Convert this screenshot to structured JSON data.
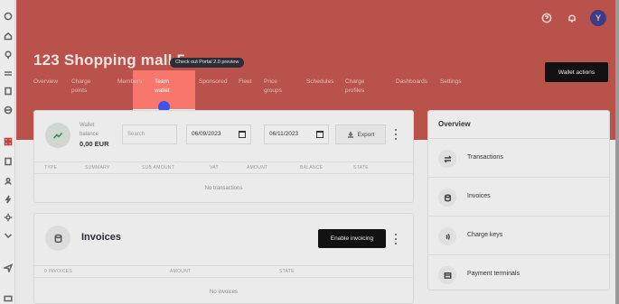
{
  "sidebar": {
    "icons": [
      "loader-icon",
      "home-icon",
      "lightbulb-icon",
      "transfer-icon",
      "invoice-icon",
      "globe-icon",
      "grid-icon",
      "building-icon",
      "bolt-icon",
      "sun-icon",
      "route-icon",
      "send-icon",
      "card-icon"
    ]
  },
  "header": {
    "title": "123 Shopping mall 5",
    "portal_badge": "Check out Portal 2.0 preview",
    "wallet_actions": "Wallet actions",
    "avatar_initial": "Y"
  },
  "tabs": [
    {
      "label": "Overview"
    },
    {
      "label": "Charge\npoints"
    },
    {
      "label": "Members"
    },
    {
      "label": "Team\nwallet"
    },
    {
      "label": "Sponsored"
    },
    {
      "label": "Fleet"
    },
    {
      "label": "Price\ngroups"
    },
    {
      "label": "Schedules"
    },
    {
      "label": "Charge\nprofiles"
    },
    {
      "label": "Dashboards"
    },
    {
      "label": "Settings"
    }
  ],
  "wallet": {
    "label_line1": "Wallet",
    "label_line2": "balance",
    "amount": "0,00 EUR",
    "search_placeholder": "Search",
    "date_from": "06/09/2023",
    "date_to": "06/11/2023",
    "export_label": "Export",
    "columns": [
      "TYPE",
      "SUMMARY",
      "SUB AMOUNT",
      "VAT",
      "AMOUNT",
      "BALANCE",
      "STATE"
    ],
    "empty_text": "No transactions"
  },
  "invoices": {
    "title": "Invoices",
    "enable_label": "Enable invoicing",
    "columns": [
      "0 INVOICES",
      "AMOUNT",
      "STATE"
    ],
    "empty_text": "No invoices"
  },
  "overview": {
    "title": "Overview",
    "items": [
      {
        "label": "Transactions",
        "icon": "arrows-swap-icon"
      },
      {
        "label": "Invoices",
        "icon": "coins-icon"
      },
      {
        "label": "Charge keys",
        "icon": "nfc-icon"
      },
      {
        "label": "Payment terminals",
        "icon": "terminal-icon"
      }
    ]
  },
  "colors": {
    "hero": "#b8524a",
    "active_tab_bg": "#f8766b",
    "cursor_dot": "#3a55f0",
    "button_dark": "#121212",
    "avatar": "#3f3b86"
  }
}
